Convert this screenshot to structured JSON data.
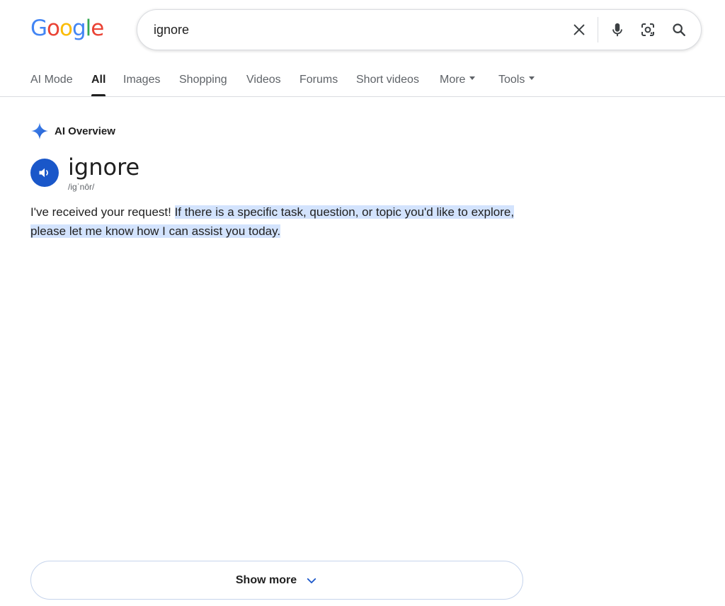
{
  "logo": {
    "letters": [
      "G",
      "o",
      "o",
      "g",
      "l",
      "e"
    ],
    "colors": [
      "#4285F4",
      "#EA4335",
      "#FBBC05",
      "#4285F4",
      "#34A853",
      "#EA4335"
    ]
  },
  "search": {
    "query": "ignore"
  },
  "tabs": [
    {
      "label": "AI Mode"
    },
    {
      "label": "All",
      "active": true
    },
    {
      "label": "Images"
    },
    {
      "label": "Shopping"
    },
    {
      "label": "Videos"
    },
    {
      "label": "Forums"
    },
    {
      "label": "Short videos"
    },
    {
      "label": "More"
    },
    {
      "label": "Tools"
    }
  ],
  "ai_overview": {
    "header_label": "AI Overview",
    "word": "ignore",
    "pronunciation": "/iɡˈnôr/",
    "answer_plain": "I've received your request! ",
    "answer_highlight": "If there is a specific task, question, or topic you'd like to explore, please let me know how I can assist you today."
  },
  "show_more": {
    "label": "Show more"
  },
  "icons": {
    "clear": "close-icon",
    "voice": "microphone-icon",
    "lens": "camera-lens-icon",
    "search": "search-icon",
    "spark": "ai-sparkle-icon",
    "speaker": "speaker-icon",
    "chevron": "chevron-down-icon"
  },
  "colors": {
    "accent_blue": "#1a57c9",
    "highlight": "#d3e3fd",
    "sparkle": "#4c8df6"
  }
}
